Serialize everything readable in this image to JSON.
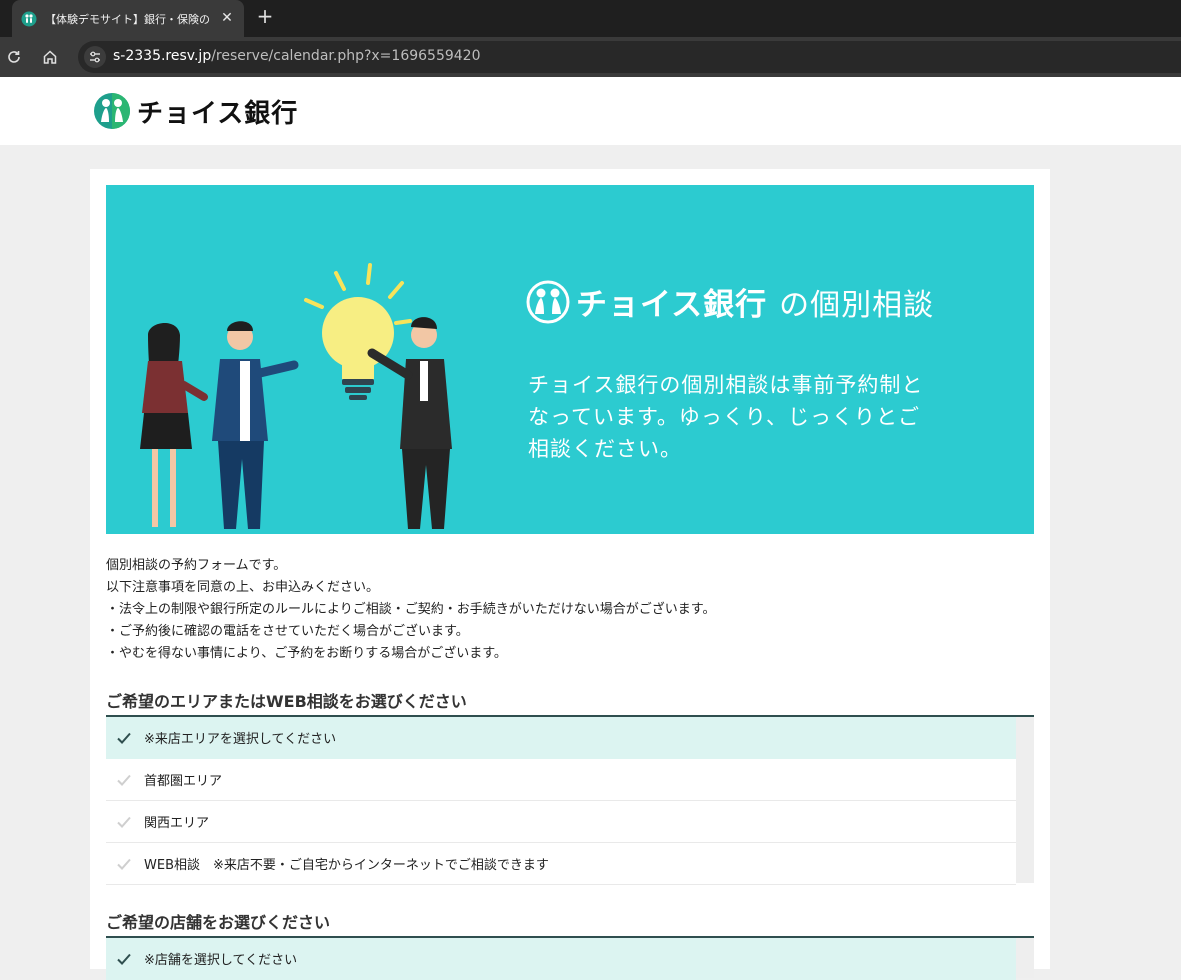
{
  "browser": {
    "tab": {
      "title": "【体験デモサイト】銀行・保険の"
    },
    "url": {
      "host": "s-2335.resv.jp",
      "path": "/reserve/calendar.php?x=1696559420"
    },
    "icons": {
      "favicon": "bank-logo-icon",
      "close": "close-icon",
      "new_tab": "plus-icon",
      "reload": "reload-icon",
      "home": "home-icon",
      "site_info": "tune-icon"
    }
  },
  "header": {
    "brand_name": "チョイス銀行",
    "logo": "bank-logo-icon"
  },
  "hero": {
    "brand_name": "チョイス銀行",
    "brand_suffix": "の個別相談",
    "lines": [
      "チョイス銀行の個別相談は事前予約制と",
      "なっています。ゆっくり、じっくりとご",
      "相談ください。"
    ],
    "illustration": "people-with-lightbulb-illustration",
    "bg_color": "#2ccbd0"
  },
  "notice": [
    "個別相談の予約フォームです。",
    "以下注意事項を同意の上、お申込みください。",
    "・法令上の制限や銀行所定のルールによりご相談・ご契約・お手続きがいただけない場合がございます。",
    "・ご予約後に確認の電話をさせていただく場合がございます。",
    "・やむを得ない事情により、ご予約をお断りする場合がございます。"
  ],
  "area_section": {
    "heading": "ご希望のエリアまたはWEB相談をお選びください",
    "options": [
      {
        "label": "※来店エリアを選択してください",
        "selected": true
      },
      {
        "label": "首都圏エリア",
        "selected": false
      },
      {
        "label": "関西エリア",
        "selected": false
      },
      {
        "label": "WEB相談　※来店不要・ご自宅からインターネットでご相談できます",
        "selected": false
      }
    ]
  },
  "store_section": {
    "heading": "ご希望の店舗をお選びください",
    "options": [
      {
        "label": "※店舗を選択してください",
        "selected": true
      }
    ]
  },
  "colors": {
    "selected_bg": "#dcf4f1",
    "check_selected": "#2f4f4f",
    "check_unselected": "#cfcfcf",
    "rule": "#2f4f4f"
  }
}
